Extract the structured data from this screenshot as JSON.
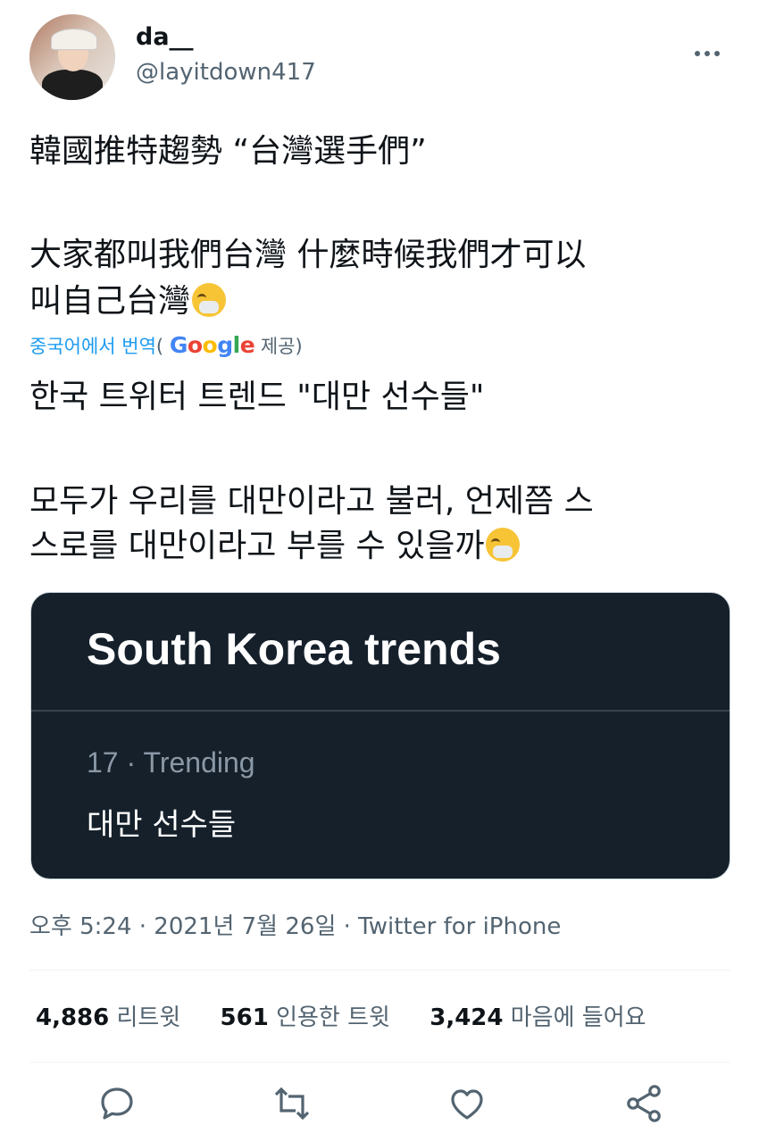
{
  "user": {
    "display_name": "da__",
    "handle": "@layitdown417"
  },
  "tweet": {
    "line1": "韓國推特趨勢 “台灣選手們”",
    "line2": "大家都叫我們台灣 什麼時候我們才可以",
    "line3": "叫自己台灣",
    "emoji": "sneezing-face-emoji"
  },
  "translation": {
    "label": "중국어에서 번역",
    "paren_open": "(",
    "provider": "Google",
    "provided": "제공)",
    "line1": "한국 트위터 트렌드 \"대만 선수들\"",
    "line2": " 모두가 우리를 대만이라고 불러, 언제쯤 스",
    "line3": "스로를 대만이라고 부를 수 있을까"
  },
  "card": {
    "title": "South Korea trends",
    "meta": "17 · Trending",
    "topic": "대만 선수들"
  },
  "meta": {
    "timestamp": "오후 5:24 · 2021년 7월 26일 · Twitter for iPhone"
  },
  "stats": {
    "retweets_count": "4,886",
    "retweets_label": "리트윗",
    "quotes_count": "561",
    "quotes_label": "인용한 트윗",
    "likes_count": "3,424",
    "likes_label": "마음에 들어요"
  },
  "actions": [
    "reply-icon",
    "retweet-icon",
    "like-icon",
    "share-icon"
  ],
  "colors": {
    "text": "#0f1419",
    "secondary": "#536471",
    "link": "#1d9bf0",
    "card_bg": "#15202b"
  }
}
